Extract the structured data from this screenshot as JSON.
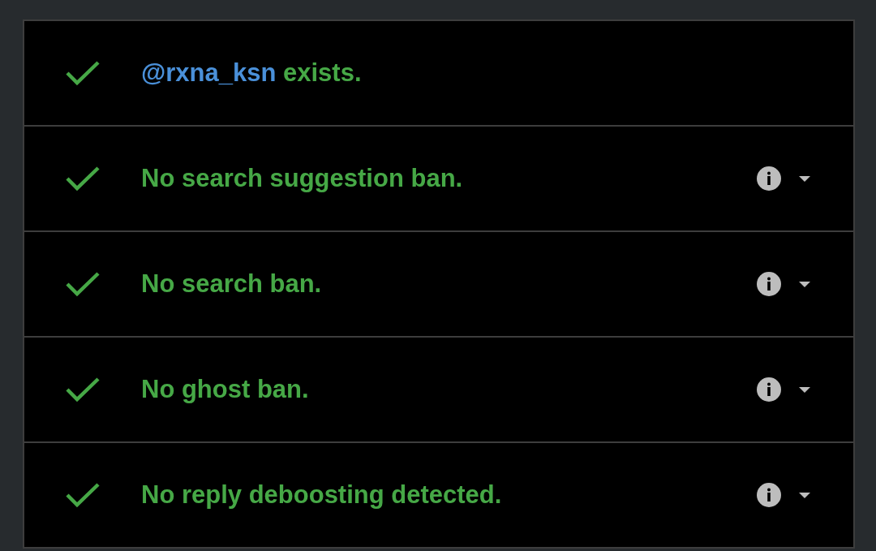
{
  "checks": [
    {
      "kind": "account",
      "passed": true,
      "handle": "@rxna_ksn",
      "text": "exists."
    },
    {
      "kind": "test",
      "passed": true,
      "text": "No search suggestion ban.",
      "expanded": false
    },
    {
      "kind": "test",
      "passed": true,
      "text": "No search ban.",
      "expanded": false
    },
    {
      "kind": "test",
      "passed": true,
      "text": "No ghost ban.",
      "expanded": false
    },
    {
      "kind": "test",
      "passed": true,
      "text": "No reply deboosting detected.",
      "expanded": false
    }
  ]
}
